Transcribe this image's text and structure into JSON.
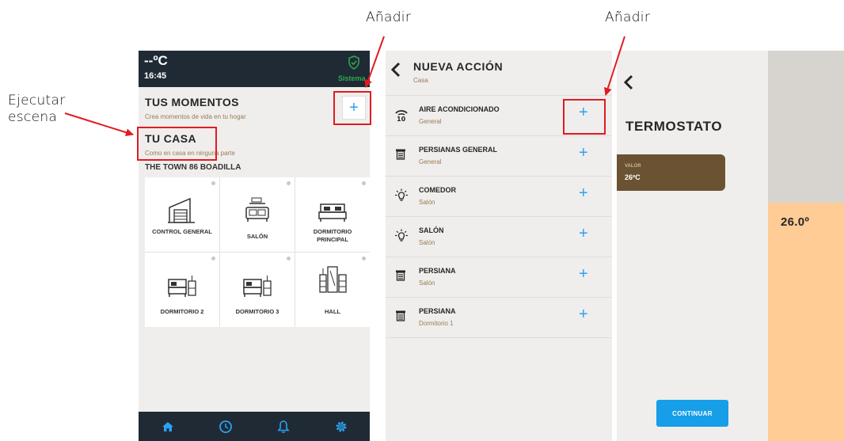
{
  "annotations": {
    "add_top_left": "Añadir",
    "add_top_right": "Añadir",
    "execute_scene": "Ejecutar\nescena"
  },
  "colors": {
    "annotation_red": "#e11b22",
    "accent_blue": "#2aa2f0",
    "header_dark": "#1f2a35",
    "subtitle_brown": "#9b7a55",
    "value_card_brown": "#6b5233",
    "thermo_orange": "#fecc94",
    "status_green": "#2ea84a"
  },
  "home_panel": {
    "temperature": "--ºC",
    "time": "16:45",
    "status_label": "Sistema",
    "moments_title": "TUS MOMENTOS",
    "moments_subtitle": "Crea momentos de vida en tu hogar",
    "home_title": "TU CASA",
    "home_subtitle": "Como en casa en ninguna parte",
    "location": "THE TOWN 86 BOADILLA",
    "rooms": [
      {
        "label": "CONTROL GENERAL",
        "icon": "garage-icon"
      },
      {
        "label": "SALÓN",
        "icon": "sofa-icon"
      },
      {
        "label": "DORMITORIO PRINCIPAL",
        "icon": "bed-icon"
      },
      {
        "label": "DORMITORIO 2",
        "icon": "bed-nightstand-icon"
      },
      {
        "label": "DORMITORIO 3",
        "icon": "bed-nightstand-icon"
      },
      {
        "label": "HALL",
        "icon": "wardrobe-icon"
      }
    ],
    "nav": [
      "home-icon",
      "clock-icon",
      "bell-icon",
      "gear-icon"
    ]
  },
  "action_panel": {
    "title": "NUEVA ACCIÓN",
    "subtitle": "Casa",
    "actions": [
      {
        "name": "AIRE ACONDICIONADO",
        "room": "General",
        "icon": "air-conditioner-icon"
      },
      {
        "name": "PERSIANAS GENERAL",
        "room": "General",
        "icon": "blind-icon"
      },
      {
        "name": "COMEDOR",
        "room": "Salón",
        "icon": "light-bulb-icon"
      },
      {
        "name": "SALÓN",
        "room": "Salón",
        "icon": "light-bulb-icon"
      },
      {
        "name": "PERSIANA",
        "room": "Salón",
        "icon": "blind-icon"
      },
      {
        "name": "PERSIANA",
        "room": "Dormitorio 1",
        "icon": "blind-icon"
      }
    ]
  },
  "thermostat_panel": {
    "title": "TERMOSTATO",
    "value_label": "VALOR",
    "value": "26ºC",
    "continue_label": "CONTINUAR",
    "side_value": "26.0º"
  }
}
